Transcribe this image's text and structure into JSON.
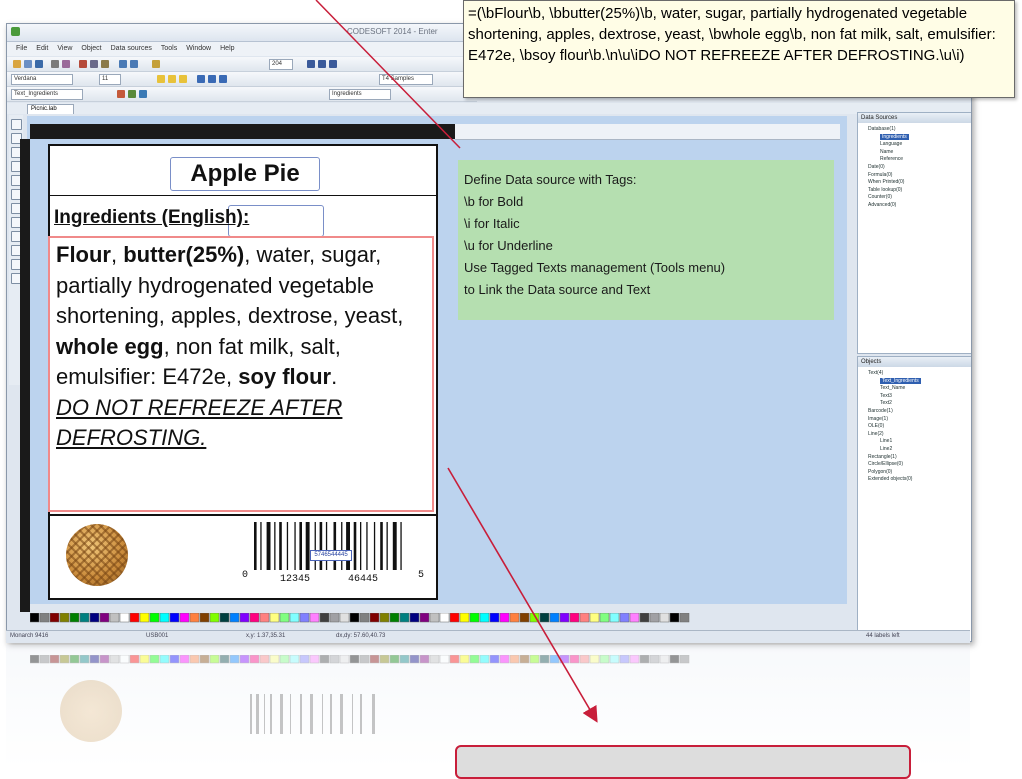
{
  "app": {
    "title": "CODESOFT 2014 - Enter",
    "menu": [
      "File",
      "Edit",
      "View",
      "Object",
      "Data sources",
      "Tools",
      "Window",
      "Help"
    ],
    "font_name": "Verdana",
    "font_size": "11",
    "zoom": "204",
    "text_samples_label": "T4 Samples",
    "object_name": "Text_Ingredients",
    "data_source_name": "Ingredients",
    "document_tab": "Picnic.lab"
  },
  "tooltip": {
    "text": "=(\\bFlour\\b, \\bbutter(25%)\\b, water, sugar, partially hydrogenated vegetable shortening, apples, dextrose, yeast, \\bwhole egg\\b, non fat milk, salt, emulsifier: E472e, \\bsoy flour\\b.\\n\\u\\iDO NOT REFREEZE AFTER DEFROSTING.\\u\\i)"
  },
  "label": {
    "title": "Apple Pie",
    "ingredients_heading": "Ingredients (English):",
    "ingredients": [
      {
        "t": "Flour",
        "b": true
      },
      {
        "t": ", "
      },
      {
        "t": "butter(25%)",
        "b": true
      },
      {
        "t": ", water, sugar, partially hydrogenated vegetable shortening, apples, dextrose, yeast, "
      },
      {
        "t": "whole egg",
        "b": true
      },
      {
        "t": ", non fat milk, salt, emulsifier: E472e, "
      },
      {
        "t": "soy flour",
        "b": true
      },
      {
        "t": "."
      }
    ],
    "warning": "DO NOT REFREEZE AFTER DEFROSTING.",
    "barcode_digits": [
      "0",
      "12345",
      "46445",
      "5"
    ],
    "barcode_caption": "5746544445"
  },
  "note": {
    "lines": [
      "Define Data source with Tags:",
      "\\b for Bold",
      "\\i for Italic",
      "\\u for Underline",
      "Use Tagged Texts management (Tools menu)",
      "to Link the Data source and Text"
    ]
  },
  "data_sources_pane": {
    "title": "Data Sources",
    "items": [
      "Database(1)",
      "Ingredients",
      "Language",
      "Name",
      "Reference",
      "Date(0)",
      "Formula(0)",
      "When Printed(0)",
      "Table lookup(0)",
      "Counter(0)",
      "Advanced(0)"
    ]
  },
  "objects_pane": {
    "title": "Objects",
    "items": [
      "Text(4)",
      "Text_Ingredients",
      "Text_Name",
      "Text3",
      "Text2",
      "Barcode(1)",
      "Image(1)",
      "OLE(0)",
      "Line(2)",
      "Line1",
      "Line2",
      "Rectangle(1)",
      "Circle/Ellipse(0)",
      "Polygon(0)",
      "Extended objects(0)"
    ]
  },
  "status": {
    "printer": "Monarch 9416",
    "port": "USB001",
    "cursor": "x,y: 1.37,35.31",
    "size": "dx,dy: 57.60,40.73",
    "labels_left": "44 labels left"
  },
  "colors": {
    "label_border": "#111111",
    "tooltip_bg": "#fffde6",
    "note_bg": "#b5dfb0",
    "canvas_bg": "#bcd3ee",
    "arrow": "#c81e3a"
  }
}
